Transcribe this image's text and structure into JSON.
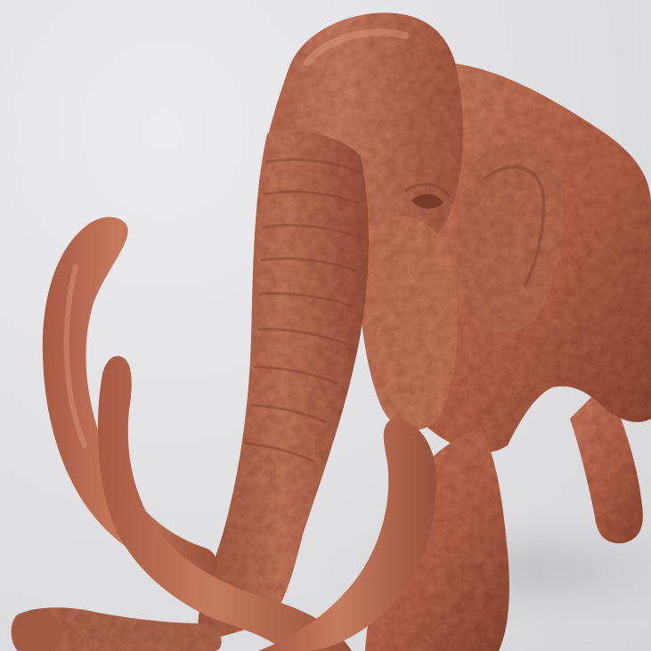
{
  "scene": {
    "subject": "mammoth-figurine-render",
    "colors": {
      "background": "#e4e4e6",
      "clay_base": "#b8684f",
      "clay_light": "#cf8668",
      "clay_dark": "#7e3f2d",
      "shadow": "#c8c8ca"
    }
  }
}
